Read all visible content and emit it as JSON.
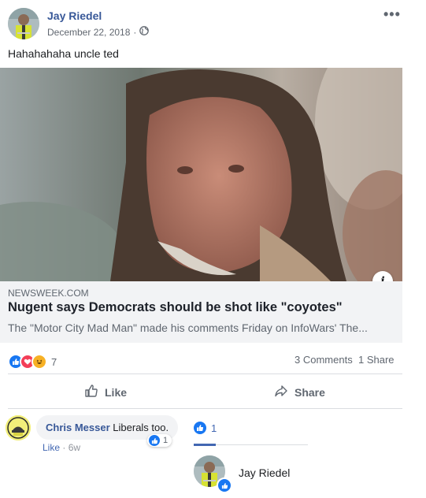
{
  "post": {
    "author": "Jay Riedel",
    "date": "December 22, 2018",
    "separator": "·",
    "privacy_icon": "globe-icon",
    "more_label": "•••",
    "text": "Hahahahaha uncle ted"
  },
  "link_preview": {
    "source": "NEWSWEEK.COM",
    "title": "Nugent says Democrats should be shot like \"coyotes\"",
    "description": "The \"Motor City Mad Man\" made his comments Friday on InfoWars' The...",
    "info_badge": "i"
  },
  "stats": {
    "reaction_icons": [
      "like-icon",
      "love-icon",
      "haha-icon"
    ],
    "reaction_count": "7",
    "comments": "3 Comments",
    "shares": "1 Share"
  },
  "actions": {
    "like_label": "Like",
    "share_label": "Share"
  },
  "comment": {
    "author": "Chris Messer",
    "text": "Liberals too.",
    "like_link": "Like",
    "separator": "·",
    "time": "6w",
    "like_count": "1"
  },
  "reactions_popup": {
    "like_count": "1",
    "person": "Jay Riedel"
  },
  "colors": {
    "brand_blue": "#385898",
    "link_blue": "#4267b2",
    "like_blue": "#1877f2",
    "love_red": "#f33e58",
    "haha_yellow": "#f7b125",
    "card_gray": "#f2f3f5",
    "muted_text": "#606770"
  }
}
